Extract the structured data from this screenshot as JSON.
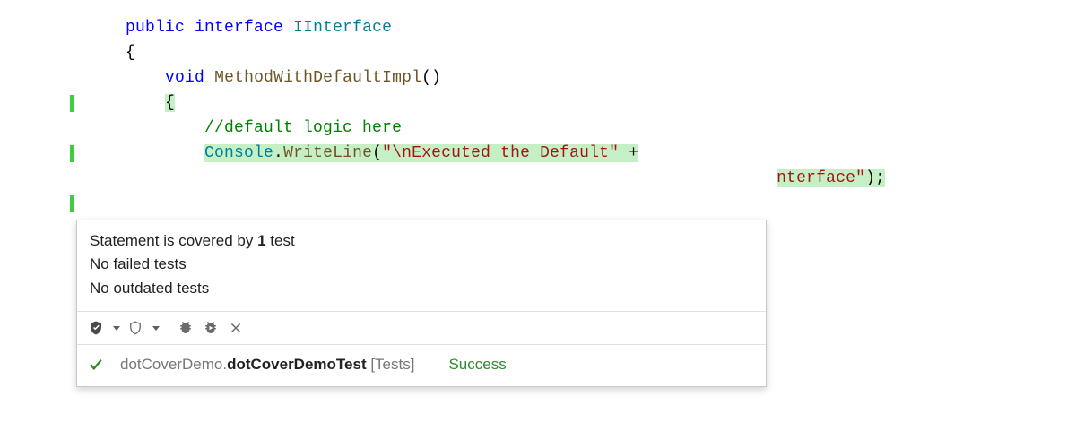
{
  "code": {
    "l1_public": "public",
    "l1_interface": "interface",
    "l1_type": "IInterface",
    "l2_brace": "{",
    "l3_void": "void",
    "l3_method": "MethodWithDefaultImpl",
    "l3_parens": "()",
    "l4_brace": "{",
    "l5_comment": "//default logic here",
    "l6_console": "Console",
    "l6_dot": ".",
    "l6_writeln": "WriteLine",
    "l6_open": "(",
    "l6_str": "\"\\nExecuted the Default\"",
    "l6_plus": " +",
    "l7_str": "nterface\"",
    "l7_close": ");"
  },
  "tooltip": {
    "line1_pre": "Statement is covered by ",
    "line1_bold": "1",
    "line1_post": " test",
    "line2": "No failed tests",
    "line3": "No outdated tests"
  },
  "result": {
    "namespace": "dotCoverDemo.",
    "class": "dotCoverDemoTest",
    "category": " [Tests]",
    "status": "Success"
  }
}
